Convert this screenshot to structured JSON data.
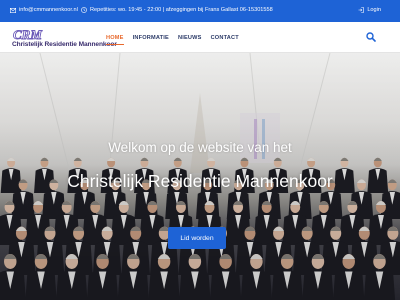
{
  "topbar": {
    "email": "info@cmmannenkoor.nl",
    "info": "Repetities: wo. 19:45 - 22:00 | afzeggingen bij Frans Gallast 06-15301558",
    "login": "Login",
    "icons": {
      "email": "envelope-icon",
      "info": "clock-icon",
      "login": "login-icon"
    },
    "background": "#1e63d6"
  },
  "logo": {
    "mark": "CRM",
    "text": "Christelijk Residentie Mannenkoor"
  },
  "nav": {
    "items": [
      {
        "label": "HOME",
        "active": true
      },
      {
        "label": "INFORMATIE",
        "active": false
      },
      {
        "label": "NIEUWS",
        "active": false
      },
      {
        "label": "CONTACT",
        "active": false
      }
    ],
    "search_icon": "search-icon",
    "active_color": "#e8692d"
  },
  "hero": {
    "subtitle": "Welkom op de website van het",
    "title": "Christelijk Residentie Mannenkoor",
    "button": "Lid worden",
    "button_color": "#1e63d6"
  }
}
